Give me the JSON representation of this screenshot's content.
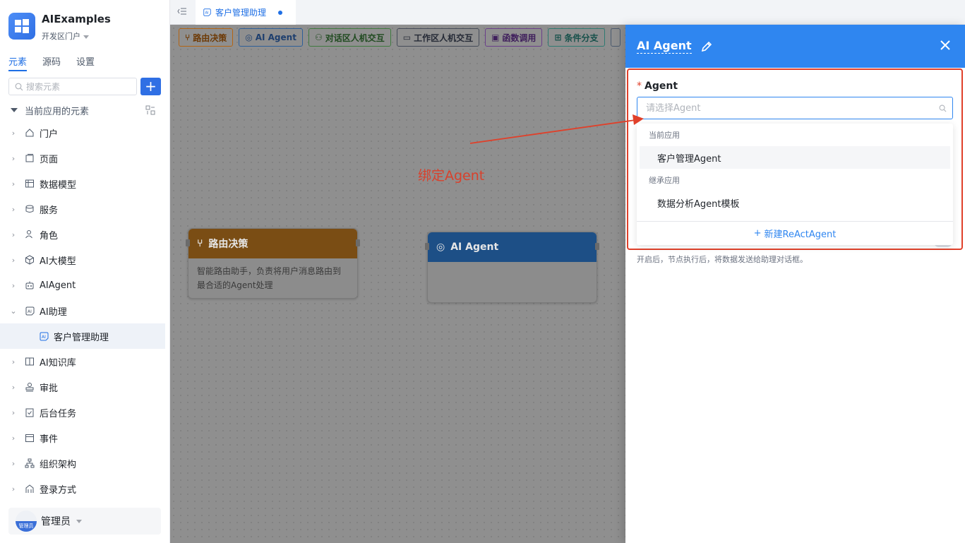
{
  "app": {
    "name": "AIExamples",
    "portal": "开发区门户"
  },
  "sidebar": {
    "tabs": [
      {
        "label": "元素",
        "active": true
      },
      {
        "label": "源码",
        "active": false
      },
      {
        "label": "设置",
        "active": false
      }
    ],
    "search_placeholder": "搜索元素",
    "tree_root_label": "当前应用的元素",
    "items": [
      {
        "label": "门户",
        "icon": "home-icon"
      },
      {
        "label": "页面",
        "icon": "page-icon"
      },
      {
        "label": "数据模型",
        "icon": "table-icon"
      },
      {
        "label": "服务",
        "icon": "service-icon"
      },
      {
        "label": "角色",
        "icon": "role-icon"
      },
      {
        "label": "AI大模型",
        "icon": "cube-icon"
      },
      {
        "label": "AIAgent",
        "icon": "robot-icon"
      },
      {
        "label": "AI助理",
        "icon": "ai-icon"
      },
      {
        "label": "AI知识库",
        "icon": "book-icon"
      },
      {
        "label": "审批",
        "icon": "stamp-icon"
      },
      {
        "label": "后台任务",
        "icon": "task-icon"
      },
      {
        "label": "事件",
        "icon": "event-icon"
      },
      {
        "label": "组织架构",
        "icon": "org-icon"
      },
      {
        "label": "登录方式",
        "icon": "login-icon"
      }
    ],
    "child_item": {
      "label": "客户管理助理",
      "icon": "ai-icon"
    },
    "user": {
      "name": "管理员",
      "avatar_text": "管理员"
    }
  },
  "topbar": {
    "doc_tab": "客户管理助理"
  },
  "toolbar": {
    "buttons": [
      {
        "label": "路由决策",
        "icon": "branch-icon"
      },
      {
        "label": "AI Agent",
        "icon": "agent-icon"
      },
      {
        "label": "对话区人机交互",
        "icon": "chat-icon"
      },
      {
        "label": "工作区人机交互",
        "icon": "monitor-icon"
      },
      {
        "label": "函数调用",
        "icon": "function-icon"
      },
      {
        "label": "条件分支",
        "icon": "condition-icon"
      }
    ]
  },
  "canvas": {
    "node_route": {
      "title": "路由决策",
      "desc": "智能路由助手，负责将用户消息路由到最合适的Agent处理"
    },
    "node_agent": {
      "title": "AI Agent"
    },
    "annotation": "绑定Agent"
  },
  "panel": {
    "title": "AI Agent",
    "field_label": "Agent",
    "field_required": "*",
    "input_placeholder": "请选择Agent",
    "groups": [
      {
        "label": "当前应用",
        "options": [
          "客户管理Agent"
        ]
      },
      {
        "label": "继承应用",
        "options": [
          "数据分析Agent模板"
        ]
      }
    ],
    "create_label": "新建ReActAgent",
    "hint": "开启后，节点执行后，将数据发送给助理对话框。"
  },
  "colors": {
    "primary": "#2f86f0",
    "accent": "#1f6fe5",
    "annotation": "#e0402a"
  }
}
